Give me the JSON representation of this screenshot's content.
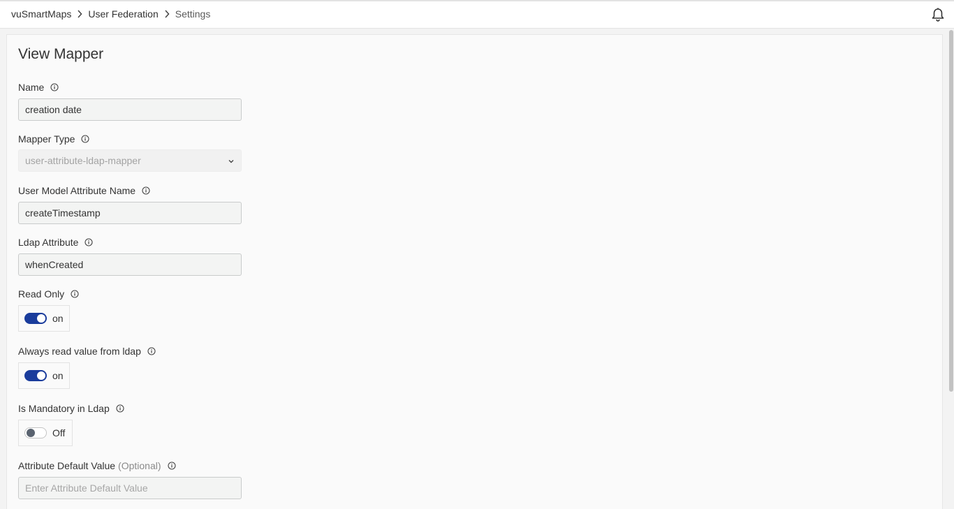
{
  "breadcrumb": {
    "items": [
      "vuSmartMaps",
      "User Federation",
      "Settings"
    ]
  },
  "icons": {
    "separator": "chevron-right-icon",
    "notifications": "bell-icon",
    "info": "info-icon",
    "select_arrow": "chevron-down-icon"
  },
  "page": {
    "title": "View Mapper"
  },
  "form": {
    "name": {
      "label": "Name",
      "value": "creation date"
    },
    "mapper_type": {
      "label": "Mapper Type",
      "value": "user-attribute-ldap-mapper"
    },
    "user_model_attribute": {
      "label": "User Model Attribute Name",
      "value": "createTimestamp"
    },
    "ldap_attribute": {
      "label": "Ldap Attribute",
      "value": "whenCreated"
    },
    "read_only": {
      "label": "Read Only",
      "state_text": "on",
      "checked": true
    },
    "always_read": {
      "label": "Always read value from ldap",
      "state_text": "on",
      "checked": true
    },
    "mandatory": {
      "label": "Is Mandatory in Ldap",
      "state_text": "Off",
      "checked": false
    },
    "default_value": {
      "label": "Attribute Default Value",
      "optional_text": "(Optional)",
      "value": "",
      "placeholder": "Enter Attribute Default Value"
    }
  },
  "colors": {
    "toggle_on": "#1a3c9c",
    "toggle_off_knob": "#5a6370",
    "page_background": "#f3f3f3",
    "card_background": "#fafafa"
  }
}
